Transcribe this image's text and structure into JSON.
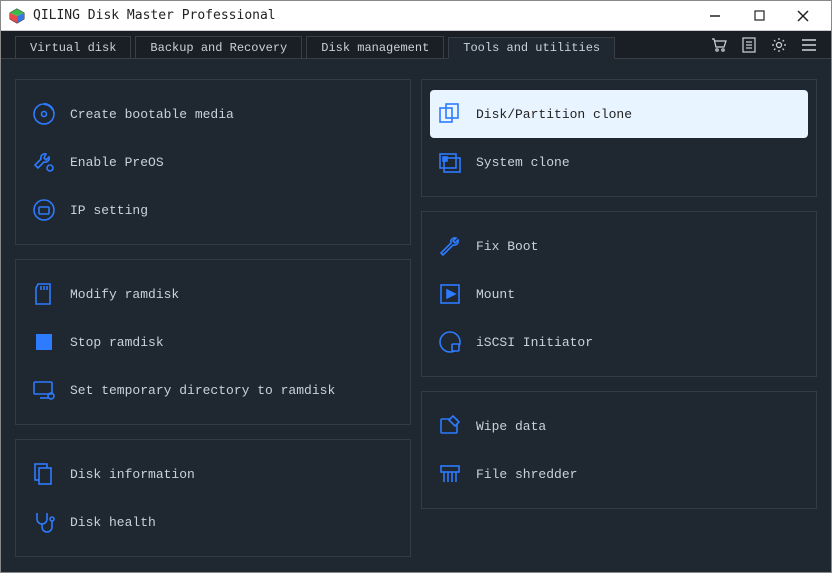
{
  "window": {
    "title": "QILING Disk Master Professional"
  },
  "tabs": {
    "t0": "Virtual disk",
    "t1": "Backup and Recovery",
    "t2": "Disk management",
    "t3": "Tools and utilities"
  },
  "left": {
    "group1": {
      "i0": "Create bootable media",
      "i1": "Enable PreOS",
      "i2": "IP setting"
    },
    "group2": {
      "i0": "Modify ramdisk",
      "i1": "Stop ramdisk",
      "i2": "Set temporary directory to ramdisk"
    },
    "group3": {
      "i0": "Disk information",
      "i1": "Disk health"
    }
  },
  "right": {
    "group1": {
      "i0": "Disk/Partition clone",
      "i1": "System clone"
    },
    "group2": {
      "i0": "Fix Boot",
      "i1": "Mount",
      "i2": "iSCSI Initiator"
    },
    "group3": {
      "i0": "Wipe data",
      "i1": "File shredder"
    }
  }
}
